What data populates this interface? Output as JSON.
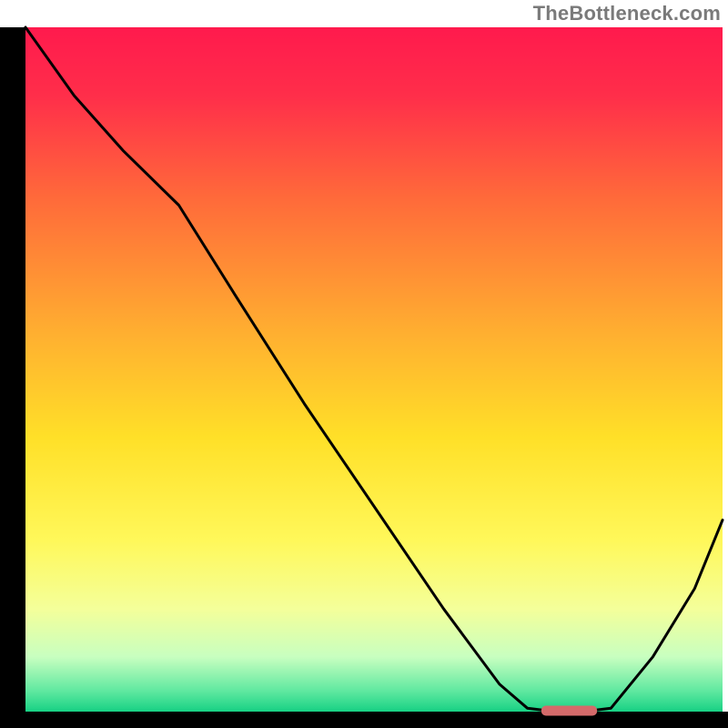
{
  "watermark": "TheBottleneck.com",
  "chart_data": {
    "type": "line",
    "title": "",
    "xlabel": "",
    "ylabel": "",
    "xlim": [
      0,
      100
    ],
    "ylim": [
      0,
      100
    ],
    "grid": false,
    "legend": false,
    "background_gradient": {
      "stops": [
        {
          "offset": 0.0,
          "color": "#ff1a4d"
        },
        {
          "offset": 0.1,
          "color": "#ff2e4a"
        },
        {
          "offset": 0.25,
          "color": "#ff6a3a"
        },
        {
          "offset": 0.45,
          "color": "#ffb030"
        },
        {
          "offset": 0.6,
          "color": "#ffe028"
        },
        {
          "offset": 0.75,
          "color": "#fff85a"
        },
        {
          "offset": 0.85,
          "color": "#f4ff9a"
        },
        {
          "offset": 0.92,
          "color": "#c8ffc0"
        },
        {
          "offset": 0.97,
          "color": "#5fe8a0"
        },
        {
          "offset": 1.0,
          "color": "#17d184"
        }
      ]
    },
    "series": [
      {
        "name": "bottleneck-curve",
        "color": "#000000",
        "stroke_width": 3,
        "x": [
          0.0,
          7.0,
          14.0,
          22.0,
          30.0,
          40.0,
          50.0,
          60.0,
          68.0,
          72.0,
          76.0,
          80.0,
          84.0,
          90.0,
          96.0,
          100.0
        ],
        "y": [
          100.0,
          90.0,
          82.0,
          74.0,
          61.0,
          45.0,
          30.0,
          15.0,
          4.0,
          0.5,
          0.0,
          0.0,
          0.5,
          8.0,
          18.0,
          28.0
        ]
      }
    ],
    "marker": {
      "name": "optimal-range-marker",
      "color": "#d46a6a",
      "x_start": 74.0,
      "x_end": 82.0,
      "y": 0.0,
      "thickness": 3
    },
    "axes": {
      "color": "#000000",
      "left_width": 28,
      "bottom_height": 18
    }
  }
}
